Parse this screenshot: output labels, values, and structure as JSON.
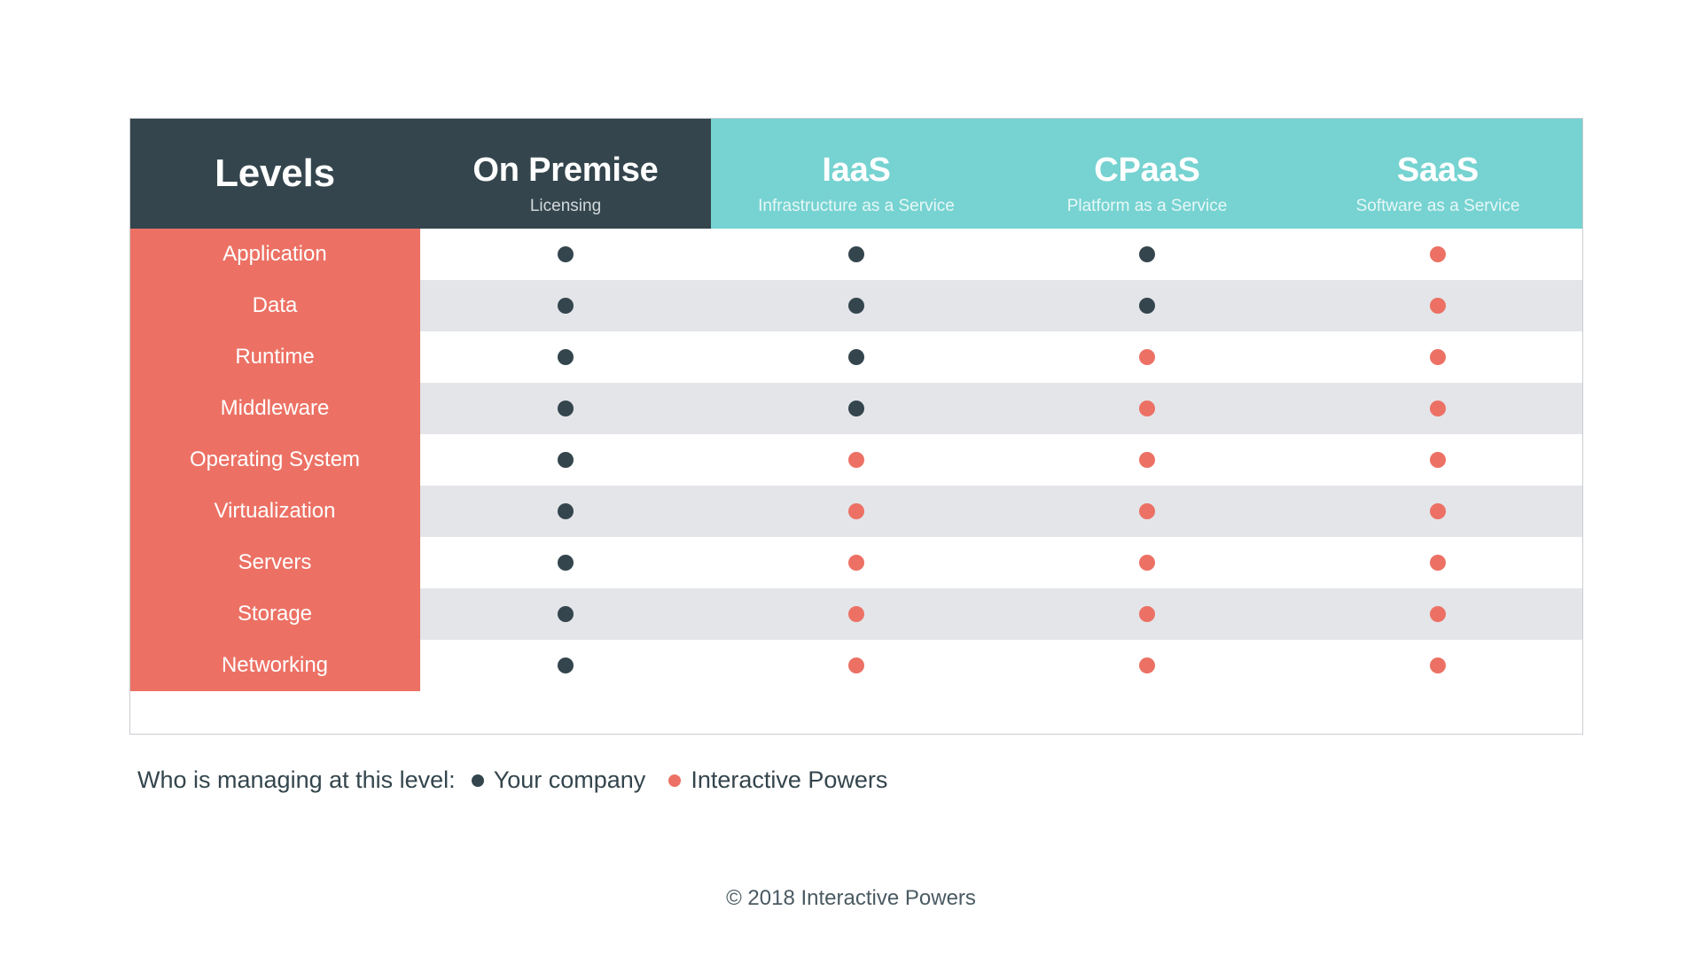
{
  "colors": {
    "dark": "#34454d",
    "teal": "#76d3d1",
    "coral": "#ec7164",
    "stripe": "#e3e5e9",
    "white": "#ffffff"
  },
  "table": {
    "levels_header": "Levels",
    "columns": [
      {
        "title": "On Premise",
        "subtitle": "Licensing",
        "style": "dark"
      },
      {
        "title": "IaaS",
        "subtitle": "Infrastructure as a Service",
        "style": "teal"
      },
      {
        "title": "CPaaS",
        "subtitle": "Platform as a Service",
        "style": "teal"
      },
      {
        "title": "SaaS",
        "subtitle": "Software as a Service",
        "style": "teal"
      }
    ],
    "rows": [
      {
        "level": "Application",
        "cells": [
          "company",
          "company",
          "company",
          "provider"
        ]
      },
      {
        "level": "Data",
        "cells": [
          "company",
          "company",
          "company",
          "provider"
        ]
      },
      {
        "level": "Runtime",
        "cells": [
          "company",
          "company",
          "provider",
          "provider"
        ]
      },
      {
        "level": "Middleware",
        "cells": [
          "company",
          "company",
          "provider",
          "provider"
        ]
      },
      {
        "level": "Operating System",
        "cells": [
          "company",
          "provider",
          "provider",
          "provider"
        ]
      },
      {
        "level": "Virtualization",
        "cells": [
          "company",
          "provider",
          "provider",
          "provider"
        ]
      },
      {
        "level": "Servers",
        "cells": [
          "company",
          "provider",
          "provider",
          "provider"
        ]
      },
      {
        "level": "Storage",
        "cells": [
          "company",
          "provider",
          "provider",
          "provider"
        ]
      },
      {
        "level": "Networking",
        "cells": [
          "company",
          "provider",
          "provider",
          "provider"
        ]
      }
    ]
  },
  "legend": {
    "lead": "Who is managing at this level:",
    "entries": [
      {
        "key": "company",
        "label": "Your company",
        "color": "#34454d"
      },
      {
        "key": "provider",
        "label": "Interactive Powers",
        "color": "#ec7164"
      }
    ]
  },
  "footer": {
    "copyright": "© 2018 Interactive Powers"
  }
}
